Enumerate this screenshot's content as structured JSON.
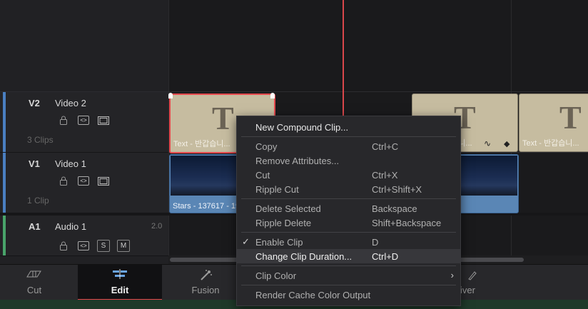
{
  "tracks": [
    {
      "id": "V2",
      "name": "Video 2",
      "clips": "3 Clips",
      "color": "#4a7fc1"
    },
    {
      "id": "V1",
      "name": "Video 1",
      "clips": "1 Clip",
      "color": "#4a7fc1"
    },
    {
      "id": "A1",
      "name": "Audio 1",
      "level": "2.0",
      "color": "#49a46a",
      "solo": "S",
      "mute": "M"
    }
  ],
  "clips": {
    "title_1": "Text - 반갑습니...",
    "title_2": "Text - 반갑습니...",
    "title_3": "Text - 반갑습니...",
    "title_letter": "T",
    "video_1": "Stars - 137617 - 19..."
  },
  "context_menu": {
    "items": [
      {
        "label": "New Compound Clip...",
        "shortcut": ""
      },
      {
        "label": "Copy",
        "shortcut": "Ctrl+C"
      },
      {
        "label": "Remove Attributes...",
        "shortcut": ""
      },
      {
        "label": "Cut",
        "shortcut": "Ctrl+X"
      },
      {
        "label": "Ripple Cut",
        "shortcut": "Ctrl+Shift+X"
      },
      {
        "label": "Delete Selected",
        "shortcut": "Backspace"
      },
      {
        "label": "Ripple Delete",
        "shortcut": "Shift+Backspace"
      },
      {
        "label": "Enable Clip",
        "shortcut": "D",
        "checked": true
      },
      {
        "label": "Change Clip Duration...",
        "shortcut": "Ctrl+D",
        "highlighted": true
      },
      {
        "label": "Clip Color",
        "shortcut": "",
        "submenu": true
      },
      {
        "label": "Render Cache Color Output",
        "shortcut": ""
      }
    ]
  },
  "page_tabs": [
    {
      "label": "Cut",
      "icon": "cut-page-icon"
    },
    {
      "label": "Edit",
      "icon": "edit-page-icon",
      "active": true
    },
    {
      "label": "Fusion",
      "icon": "fusion-page-icon"
    },
    {
      "label": "iver",
      "icon": "deliver-page-icon"
    }
  ],
  "colors": {
    "playhead": "#e5484d",
    "accent": "#6aa4e0",
    "title_clip": "#c6bca0",
    "video_clip": "#5a86b5"
  }
}
